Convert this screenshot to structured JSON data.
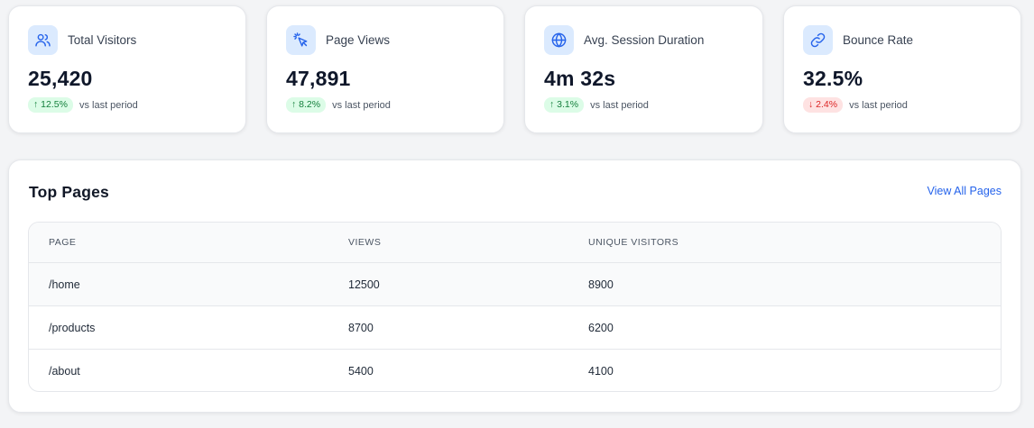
{
  "stats": [
    {
      "title": "Total Visitors",
      "value": "25,420",
      "change": "↑ 12.5%",
      "direction": "up",
      "compare": "vs last period",
      "icon": "users-icon"
    },
    {
      "title": "Page Views",
      "value": "47,891",
      "change": "↑ 8.2%",
      "direction": "up",
      "compare": "vs last period",
      "icon": "cursor-click-icon"
    },
    {
      "title": "Avg. Session Duration",
      "value": "4m 32s",
      "change": "↑ 3.1%",
      "direction": "up",
      "compare": "vs last period",
      "icon": "globe-icon"
    },
    {
      "title": "Bounce Rate",
      "value": "32.5%",
      "change": "↓ 2.4%",
      "direction": "down",
      "compare": "vs last period",
      "icon": "link-icon"
    }
  ],
  "top_pages": {
    "title": "Top Pages",
    "view_all_label": "View All Pages",
    "columns": [
      "PAGE",
      "VIEWS",
      "UNIQUE VISITORS"
    ],
    "rows": [
      {
        "page": "/home",
        "views": "12500",
        "unique": "8900"
      },
      {
        "page": "/products",
        "views": "8700",
        "unique": "6200"
      },
      {
        "page": "/about",
        "views": "5400",
        "unique": "4100"
      }
    ]
  },
  "colors": {
    "accent": "#2563eb",
    "icon_bg": "#dbeafe",
    "up_bg": "#dcfce7",
    "up_text": "#15803d",
    "down_bg": "#fee2e2",
    "down_text": "#dc2626"
  }
}
